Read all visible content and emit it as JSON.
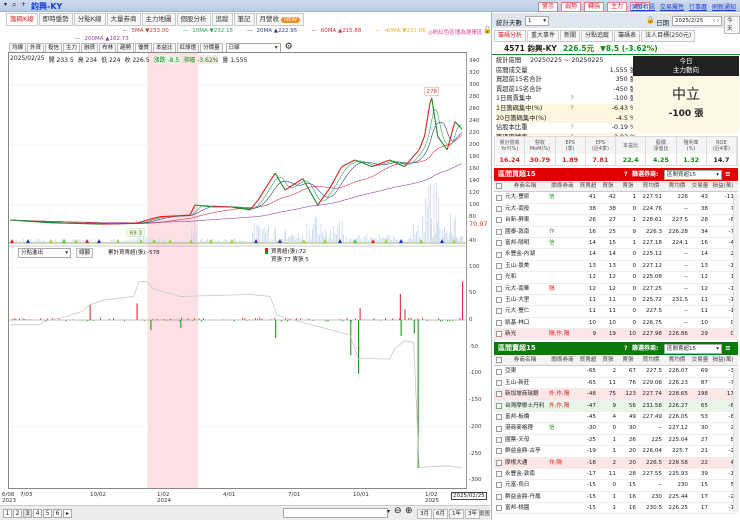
{
  "window": {
    "title": "鈞興-KY",
    "search_icon": "magnifier-icon"
  },
  "top_buttons": [
    "警示",
    "弱勢",
    "轉強",
    "主力",
    "地位"
  ],
  "top_links": [
    "個股資訊",
    "交易屬性",
    "行事曆",
    "刷新通知"
  ],
  "tabs": [
    {
      "label": "籌碼K線",
      "active": true
    },
    {
      "label": "即時盤勢"
    },
    {
      "label": "分點K線"
    },
    {
      "label": "大量券商"
    },
    {
      "label": "主力地圖"
    },
    {
      "label": "個股分析"
    },
    {
      "label": "追蹤"
    },
    {
      "label": "筆記"
    },
    {
      "label": "月營收",
      "badge": "NEW"
    }
  ],
  "ma_legend": [
    {
      "label": "5MA ▼233.00",
      "color": "#c0392b"
    },
    {
      "label": "10MA ▼232.15",
      "color": "#27a060"
    },
    {
      "label": "20MA ▲222.95",
      "color": "#2c3e90"
    },
    {
      "label": "60MA ▲215.88",
      "color": "#e0303a"
    },
    {
      "label": "40MA ▼222.06",
      "color": "#f0b030"
    },
    {
      "label": "200MA ▲162.73",
      "color": "#8e44ad"
    }
  ],
  "pink_hint": "◎粉紅色區塊為選擇區",
  "toolbar": {
    "buttons": [
      "均線",
      "外資",
      "投信",
      "主力",
      "融資",
      "布林",
      "趨勢",
      "優質",
      "本益比",
      "紅綠燈",
      "分價量"
    ],
    "period": "日線"
  },
  "quote_line": {
    "date": "2025/02/25",
    "open": "開 233.5",
    "high": "高 234",
    "low": "低 224",
    "close": "收 226.5",
    "change": "漲跌 -8.5",
    "pct": "漲幅 -3.62%",
    "volume": "量 1,555"
  },
  "chart": {
    "y_ticks": [
      "340",
      "320",
      "300",
      "280",
      "260",
      "240",
      "220",
      "200",
      "180",
      "160",
      "140",
      "120",
      "100",
      "80",
      "40"
    ],
    "volume_label": "70.97",
    "low_label": "69.3",
    "high_label": "278",
    "x_ticks": [
      [
        "6/08",
        "2023"
      ],
      [
        "7/03",
        ""
      ],
      [
        "10/02",
        ""
      ],
      [
        "1/02",
        "2024"
      ],
      [
        "4/01",
        ""
      ],
      [
        "7/01",
        ""
      ],
      [
        "10/01",
        ""
      ],
      [
        "1/02",
        "2025"
      ]
    ],
    "last_date": "2025/02/25",
    "lower_y_ticks": [
      "100",
      "50",
      "0",
      "-50",
      "-100",
      "-150",
      "-200",
      "-250",
      "-300"
    ],
    "indicator_select": "分點進出",
    "indicator_button": "總額",
    "cum_label": "累計買賣超(張):-578",
    "day_label": "買賣超(張):72",
    "day_detail": "買張 77 賣張 5"
  },
  "chart_data": {
    "type": "line",
    "selection": {
      "start": "2023-12-13",
      "end": "2024-02-20"
    },
    "price": [
      [
        "2023-06-08",
        75
      ],
      [
        "2023-08-04",
        70.5
      ],
      [
        "2023-10-09",
        68.3
      ],
      [
        "2023-11-27",
        69.3
      ],
      [
        "2023-12-13",
        75
      ],
      [
        "2023-12-30",
        80.5
      ],
      [
        "2024-02-09",
        83
      ],
      [
        "2024-02-16",
        100
      ],
      [
        "2024-03-10",
        97
      ],
      [
        "2024-04-04",
        97
      ],
      [
        "2024-05-02",
        92
      ],
      [
        "2024-05-13",
        108
      ],
      [
        "2024-06-06",
        153
      ],
      [
        "2024-06-20",
        125
      ],
      [
        "2024-07-15",
        144
      ],
      [
        "2024-08-05",
        100
      ],
      [
        "2024-08-22",
        128
      ],
      [
        "2024-09-08",
        164
      ],
      [
        "2024-09-27",
        175
      ],
      [
        "2024-10-19",
        164
      ],
      [
        "2024-11-11",
        175
      ],
      [
        "2024-11-30",
        164
      ],
      [
        "2024-12-19",
        192
      ],
      [
        "2024-12-26",
        215
      ],
      [
        "2025-01-02",
        270
      ],
      [
        "2025-01-05",
        278
      ],
      [
        "2025-01-15",
        214
      ],
      [
        "2025-01-31",
        192
      ],
      [
        "2025-02-13",
        239
      ],
      [
        "2025-02-25",
        226.5
      ]
    ],
    "price_ylim": [
      40,
      340
    ],
    "net_buy": [
      [
        "2023-09-25",
        28
      ],
      [
        "2023-11-28",
        31
      ],
      [
        "2023-12-17",
        -19
      ],
      [
        "2024-01-27",
        -15
      ],
      [
        "2024-06-06",
        -34
      ],
      [
        "2024-09-20",
        -66
      ],
      [
        "2024-10-01",
        -101
      ],
      [
        "2024-10-03",
        22
      ],
      [
        "2024-11-24",
        49
      ],
      [
        "2024-11-25",
        -30
      ],
      [
        "2024-11-30",
        20
      ],
      [
        "2024-12-12",
        -25
      ],
      [
        "2024-12-17",
        -277
      ],
      [
        "2025-02-25",
        72
      ]
    ],
    "cumulative": [
      [
        "2023-06-08",
        -9
      ],
      [
        "2023-07-20",
        -9
      ],
      [
        "2023-08-02",
        0
      ],
      [
        "2023-08-20",
        4
      ],
      [
        "2023-09-15",
        16
      ],
      [
        "2023-09-25",
        28
      ],
      [
        "2023-10-13",
        37
      ],
      [
        "2023-11-24",
        44
      ],
      [
        "2023-12-01",
        72
      ],
      [
        "2023-12-13",
        72
      ],
      [
        "2023-12-20",
        59
      ],
      [
        "2024-01-27",
        44
      ],
      [
        "2024-05-02",
        48
      ],
      [
        "2024-05-30",
        44
      ],
      [
        "2024-06-09",
        9
      ],
      [
        "2024-06-23",
        3
      ],
      [
        "2024-09-20",
        -28
      ],
      [
        "2024-10-01",
        -72
      ],
      [
        "2024-11-11",
        -73
      ],
      [
        "2024-11-18",
        -53
      ],
      [
        "2024-11-30",
        -39
      ],
      [
        "2024-12-12",
        -42
      ],
      [
        "2024-12-19",
        -276
      ],
      [
        "2025-01-31",
        -273
      ],
      [
        "2025-02-25",
        -277
      ]
    ],
    "lower_ylim": [
      -300,
      100
    ]
  },
  "bottom": {
    "pages": [
      "1",
      "2",
      "3",
      "4",
      "5",
      "6"
    ],
    "ranges": [
      "3月",
      "6月",
      "1年",
      "3年"
    ],
    "draw": "畫圖"
  },
  "right": {
    "days_label": "統計天數",
    "days_value": "1",
    "date_label": "日期",
    "date_value": "2025/2/25",
    "today": "今天",
    "tabs": [
      {
        "label": "籌碼分析",
        "active": true
      },
      {
        "label": "重大事件"
      },
      {
        "label": "新聞"
      },
      {
        "label": "分點追蹤"
      },
      {
        "label": "籌碼表"
      },
      {
        "label": "法人目標(250元)"
      }
    ],
    "stock": {
      "code_name": "4571 鈞興-KY",
      "price": "226.5元",
      "change": "▼8.5 (-3.62%)"
    },
    "stats": [
      {
        "label": "統計區間",
        "value": "20250225 ~ 20250225"
      },
      {
        "label": "區間成交量",
        "value": "1,555 張"
      },
      {
        "label": "買超前15名合計",
        "value": "350 張"
      },
      {
        "label": "賣超前15名合計",
        "value": "-450 張"
      },
      {
        "label": "1日買賣集中",
        "value": "-100 張",
        "help": "?"
      },
      {
        "label": "1日籌碼集中(%)",
        "value": "-6.43 %",
        "help": "?",
        "hl": true
      },
      {
        "label": "20日籌碼集中(%)",
        "value": "-4.5 %",
        "hl": true
      },
      {
        "label": "佔股本比重",
        "value": "-0.19 %",
        "help": "?"
      },
      {
        "label": "籌碼周轉率",
        "value": "2.93 %",
        "help": "?",
        "hl": true
      }
    ],
    "today_box": {
      "title": "今日",
      "subtitle": "主力動向",
      "status": "中立",
      "amount": "-100 張"
    },
    "metrics": [
      {
        "h1": "累計營收",
        "h2": "YoY(%)",
        "v": "16.24",
        "c": "#d22"
      },
      {
        "h1": "營收",
        "h2": "MoM(%)",
        "v": "30.79",
        "c": "#d22"
      },
      {
        "h1": "EPS",
        "h2": "(季)",
        "v": "1.89",
        "c": "#d22"
      },
      {
        "h1": "EPS",
        "h2": "(近4季)",
        "v": "7.81",
        "c": "#d22"
      },
      {
        "h1": "本益比",
        "h2": "",
        "v": "22.4",
        "c": "#1a8a1a"
      },
      {
        "h1": "股價",
        "h2": "淨值比",
        "v": "4.25",
        "c": "#1a8a1a"
      },
      {
        "h1": "殖利率",
        "h2": "(%)",
        "v": "1.32",
        "c": "#1a8a1a"
      },
      {
        "h1": "ROE",
        "h2": "(近4季)",
        "v": "14.7",
        "c": "#222"
      }
    ],
    "columns": [
      "券商名稱",
      "關係券商",
      "買賣超",
      "買張",
      "賣張",
      "買均價",
      "賣均價",
      "交易量",
      "損益(萬)"
    ],
    "buy": {
      "title": "區間買超15",
      "filter_label": "篩選券商:",
      "filter_value": "區間買超15",
      "help": "?",
      "color": "#e00000",
      "rows": [
        [
          "元大-豐原",
          "信",
          "41",
          "42",
          "1",
          "227.51",
          "226",
          "43",
          "-11"
        ],
        [
          "元大-南投",
          "",
          "38",
          "38",
          "0",
          "224.76",
          "--",
          "38",
          "7"
        ],
        [
          "台新-屏東",
          "",
          "26",
          "27",
          "1",
          "228.61",
          "227.5",
          "28",
          "-6"
        ],
        [
          "國泰-敦南",
          "作",
          "16",
          "25",
          "9",
          "226.3",
          "226.28",
          "34",
          "-7"
        ],
        [
          "富邦-陽明",
          "信",
          "14",
          "15",
          "1",
          "227.18",
          "224.1",
          "16",
          "-4"
        ],
        [
          "永豐金-內湖",
          "",
          "14",
          "14",
          "0",
          "225.12",
          "--",
          "14",
          "2"
        ],
        [
          "玉山-景美",
          "",
          "13",
          "13",
          "0",
          "227.12",
          "--",
          "13",
          "-1"
        ],
        [
          "光和",
          "",
          "12",
          "12",
          "0",
          "225.08",
          "--",
          "12",
          "1"
        ],
        [
          "元大-南華",
          "隔",
          "12",
          "12",
          "0",
          "227.25",
          "--",
          "12",
          "-1"
        ],
        [
          "玉山-大里",
          "",
          "11",
          "11",
          "0",
          "225.72",
          "231.5",
          "11",
          "-1"
        ],
        [
          "元大-豐仁",
          "",
          "11",
          "11",
          "0",
          "227.5",
          "--",
          "11",
          "-1"
        ],
        [
          "凱基-林口",
          "",
          "10",
          "10",
          "0",
          "226.75",
          "--",
          "10",
          "0"
        ],
        [
          "新光",
          "隔,作,隔",
          "9",
          "19",
          "10",
          "227.98",
          "226.86",
          "29",
          "0"
        ]
      ],
      "row_styles": [
        "",
        "",
        "",
        "",
        "",
        "",
        "",
        "",
        "",
        "",
        "",
        "",
        "pink"
      ]
    },
    "sell": {
      "title": "區間賣超15",
      "filter_label": "篩選券商:",
      "filter_value": "區間賣超15",
      "help": "?",
      "color": "#0a7a0a",
      "rows": [
        [
          "亞東",
          "",
          "-65",
          "2",
          "67",
          "227.5",
          "226.07",
          "69",
          "-3"
        ],
        [
          "玉山-新莊",
          "",
          "-65",
          "11",
          "76",
          "229.08",
          "226.23",
          "87",
          "-7"
        ],
        [
          "新加坡商瑞銀",
          "外,作,隔",
          "-48",
          "75",
          "123",
          "227.74",
          "228.65",
          "198",
          "17"
        ],
        [
          "台灣摩根士丹利",
          "外,作,隔",
          "-47",
          "9",
          "56",
          "231.58",
          "226.27",
          "65",
          "-6"
        ],
        [
          "富邦-板橋",
          "",
          "-45",
          "4",
          "49",
          "227.49",
          "226.05",
          "53",
          "-8"
        ],
        [
          "港商麥格理",
          "信",
          "-30",
          "0",
          "30",
          "--",
          "227.12",
          "30",
          "2"
        ],
        [
          "國票-天母",
          "",
          "-25",
          "1",
          "26",
          "225",
          "225.04",
          "27",
          "8"
        ],
        [
          "群益金鼎-古亭",
          "",
          "-19",
          "1",
          "20",
          "226.04",
          "225.7",
          "21",
          "-2"
        ],
        [
          "摩根大通",
          "作,隔",
          "-18",
          "2",
          "20",
          "226.5",
          "228.58",
          "22",
          "4"
        ],
        [
          "永豐金-敦南",
          "",
          "-17",
          "11",
          "28",
          "227.55",
          "225.93",
          "39",
          "-1"
        ],
        [
          "元富-烏日",
          "",
          "-15",
          "0",
          "15",
          "--",
          "230",
          "15",
          "5"
        ],
        [
          "群益金鼎-丹鳳",
          "",
          "-15",
          "1",
          "16",
          "230",
          "225.44",
          "17",
          "-2"
        ],
        [
          "富邦-桃園",
          "",
          "-15",
          "1",
          "16",
          "230.5",
          "226.25",
          "17",
          "-1"
        ]
      ],
      "row_styles": [
        "",
        "",
        "pink",
        "green",
        "",
        "",
        "",
        "",
        "pink",
        "",
        "",
        "",
        ""
      ]
    }
  }
}
